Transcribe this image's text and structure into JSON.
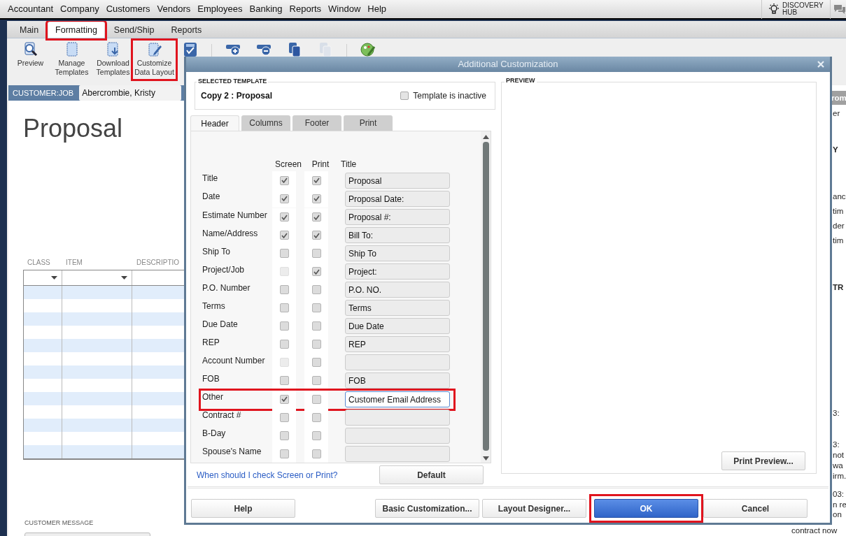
{
  "menu_bar": {
    "items": [
      "Accountant",
      "Company",
      "Customers",
      "Vendors",
      "Employees",
      "Banking",
      "Reports",
      "Window",
      "Help"
    ],
    "discovery_hub": "DISCOVERY HUB"
  },
  "ribbon_tabs": [
    {
      "label": "Main",
      "selected": false
    },
    {
      "label": "Formatting",
      "selected": true,
      "highlighted": true
    },
    {
      "label": "Send/Ship",
      "selected": false
    },
    {
      "label": "Reports",
      "selected": false
    }
  ],
  "toolbar": [
    {
      "kind": "labeled",
      "label": "Preview"
    },
    {
      "kind": "labeled",
      "label": "Manage Templates"
    },
    {
      "kind": "labeled",
      "label": "Download Templates"
    },
    {
      "kind": "labeled",
      "label": "Customize Data Layout",
      "highlighted": true
    },
    {
      "kind": "icon"
    },
    {
      "kind": "icon"
    },
    {
      "kind": "icon"
    },
    {
      "kind": "icon"
    },
    {
      "kind": "icon",
      "disabled": true
    },
    {
      "kind": "icon"
    }
  ],
  "form": {
    "customer_job_label": "CUSTOMER:JOB",
    "customer_job": "Abercrombie, Kristy",
    "title": "Proposal",
    "columns": [
      "CLASS",
      "ITEM",
      "DESCRIPTIO"
    ],
    "customer_message_label": "CUSTOMER MESSAGE"
  },
  "side_panel": [
    {
      "kind": "bar",
      "text": "rom"
    },
    {
      "kind": "text",
      "text": "er"
    },
    {
      "kind": "bold",
      "text": "Y"
    },
    {
      "kind": "text",
      "text": "anc"
    },
    {
      "kind": "text",
      "text": "tim"
    },
    {
      "kind": "text",
      "text": "der"
    },
    {
      "kind": "text",
      "text": "tim"
    },
    {
      "kind": "bold",
      "text": "TR"
    },
    {
      "kind": "text",
      "text": "3:"
    },
    {
      "kind": "text",
      "text": "3:"
    },
    {
      "kind": "text",
      "text": "not"
    },
    {
      "kind": "text",
      "text": "wa"
    },
    {
      "kind": "text",
      "text": "irm."
    },
    {
      "kind": "text",
      "text": "03:"
    },
    {
      "kind": "text",
      "text": "n re"
    },
    {
      "kind": "text",
      "text": "on"
    },
    {
      "kind": "wide",
      "text": "contract now"
    }
  ],
  "dialog": {
    "title": "Additional Customization",
    "selected_template_label": "SELECTED TEMPLATE",
    "template_name": "Copy 2 : Proposal",
    "inactive_label": "Template is inactive",
    "inactive": false,
    "tabs": [
      {
        "label": "Header",
        "selected": true
      },
      {
        "label": "Columns",
        "selected": false
      },
      {
        "label": "Footer",
        "selected": false
      },
      {
        "label": "Print",
        "selected": false
      }
    ],
    "column_headers": [
      "Screen",
      "Print",
      "Title"
    ],
    "rows": [
      {
        "label": "Title",
        "screen": true,
        "screen_disabled": false,
        "print": true,
        "title": "Proposal"
      },
      {
        "label": "Date",
        "screen": true,
        "screen_disabled": false,
        "print": true,
        "title": "Proposal Date:"
      },
      {
        "label": "Estimate Number",
        "screen": true,
        "screen_disabled": false,
        "print": true,
        "title": "Proposal #:"
      },
      {
        "label": "Name/Address",
        "screen": true,
        "screen_disabled": false,
        "print": true,
        "title": "Bill To:"
      },
      {
        "label": "Ship To",
        "screen": false,
        "screen_disabled": false,
        "print": false,
        "title": "Ship To"
      },
      {
        "label": "Project/Job",
        "screen": false,
        "screen_disabled": true,
        "print": true,
        "title": "Project:"
      },
      {
        "label": "P.O. Number",
        "screen": false,
        "screen_disabled": false,
        "print": false,
        "title": "P.O. NO."
      },
      {
        "label": "Terms",
        "screen": false,
        "screen_disabled": false,
        "print": false,
        "title": "Terms"
      },
      {
        "label": "Due Date",
        "screen": false,
        "screen_disabled": false,
        "print": false,
        "title": "Due Date"
      },
      {
        "label": "REP",
        "screen": false,
        "screen_disabled": false,
        "print": false,
        "title": "REP"
      },
      {
        "label": "Account Number",
        "screen": false,
        "screen_disabled": true,
        "print": false
      },
      {
        "label": "FOB",
        "screen": false,
        "screen_disabled": false,
        "print": false,
        "title": "FOB"
      },
      {
        "label": "Other",
        "screen": true,
        "screen_disabled": false,
        "print": false,
        "title": "Customer Email Address",
        "highlighted": true
      },
      {
        "label": "Contract #",
        "screen": false,
        "screen_disabled": false,
        "print": false
      },
      {
        "label": "B-Day",
        "screen": false,
        "screen_disabled": false,
        "print": false
      },
      {
        "label": "Spouse's Name",
        "screen": false,
        "screen_disabled": false,
        "print": false
      }
    ],
    "help_link": "When should I check Screen or Print?",
    "default_button": "Default",
    "preview_label": "PREVIEW",
    "print_preview_button": "Print Preview...",
    "buttons": [
      {
        "label": "Help",
        "kind": "plain"
      },
      {
        "label": "Basic Customization...",
        "kind": "plain"
      },
      {
        "label": "Layout Designer...",
        "kind": "plain"
      },
      {
        "label": "OK",
        "kind": "primary",
        "highlighted": true
      },
      {
        "label": "Cancel",
        "kind": "plain"
      }
    ]
  }
}
